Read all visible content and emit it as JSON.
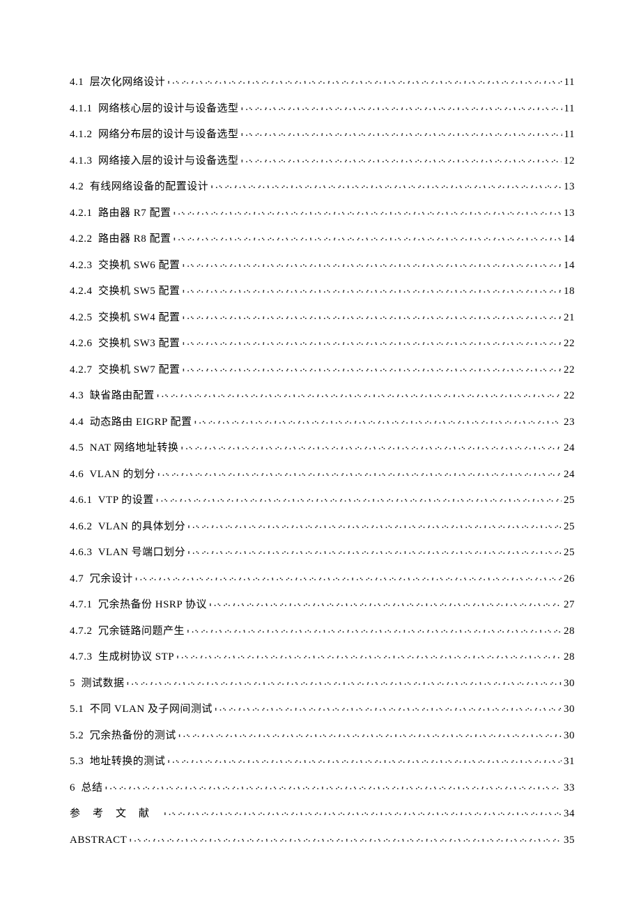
{
  "toc": [
    {
      "label": "4.1  层次化网络设计",
      "page": "11"
    },
    {
      "label": "4.1.1  网络核心层的设计与设备选型",
      "page": "11"
    },
    {
      "label": "4.1.2  网络分布层的设计与设备选型",
      "page": "11"
    },
    {
      "label": "4.1.3  网络接入层的设计与设备选型",
      "page": "12"
    },
    {
      "label": "4.2  有线网络设备的配置设计",
      "page": "13"
    },
    {
      "label": "4.2.1  路由器 R7 配置",
      "page": "13"
    },
    {
      "label": "4.2.2  路由器 R8 配置",
      "page": "14"
    },
    {
      "label": "4.2.3  交换机 SW6 配置",
      "page": "14"
    },
    {
      "label": "4.2.4  交换机 SW5 配置",
      "page": "18"
    },
    {
      "label": "4.2.5  交换机 SW4 配置",
      "page": "21"
    },
    {
      "label": "4.2.6  交换机 SW3 配置",
      "page": "22"
    },
    {
      "label": "4.2.7  交换机 SW7 配置",
      "page": "22"
    },
    {
      "label": "4.3  缺省路由配置",
      "page": "22"
    },
    {
      "label": "4.4  动态路由 EIGRP 配置",
      "page": "23"
    },
    {
      "label": "4.5  NAT 网络地址转换",
      "page": "24"
    },
    {
      "label": "4.6  VLAN 的划分",
      "page": "24"
    },
    {
      "label": "4.6.1  VTP 的设置",
      "page": "25"
    },
    {
      "label": "4.6.2  VLAN 的具体划分",
      "page": "25"
    },
    {
      "label": "4.6.3  VLAN 号端口划分",
      "page": "25"
    },
    {
      "label": "4.7  冗余设计",
      "page": "26"
    },
    {
      "label": "4.7.1  冗余热备份 HSRP 协议",
      "page": "27"
    },
    {
      "label": "4.7.2  冗余链路问题产生",
      "page": "28"
    },
    {
      "label": "4.7.3  生成树协议 STP",
      "page": "28"
    },
    {
      "label": "5  测试数据",
      "page": "30"
    },
    {
      "label": "5.1  不同 VLAN 及子网间测试",
      "page": "30"
    },
    {
      "label": "5.2  冗余热备份的测试",
      "page": "30"
    },
    {
      "label": "5.3  地址转换的测试",
      "page": "31"
    },
    {
      "label": "6  总结",
      "page": "33"
    },
    {
      "label": "参考文献",
      "page": "34",
      "refs": true
    },
    {
      "label": "ABSTRACT",
      "page": "35"
    }
  ],
  "dotchar": ". . . . . . . . . . . . . . . . . . . . . . . . . . . . . . . . . . . . . . . . . . . . . . . . . . . . . . . . . . . . . . . . . . . . . . . . . . . . . . . . . . . . . . . . . . . . . . . . . . . . . . . . . . . . . . . . . . . . . . . . . . . . . . . . . . . . . . . . . ."
}
